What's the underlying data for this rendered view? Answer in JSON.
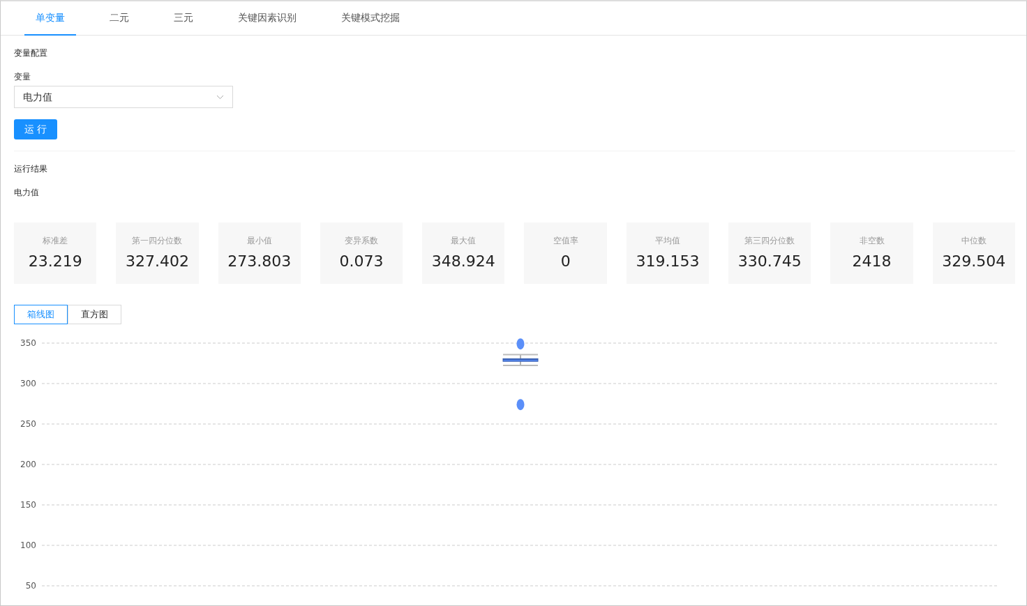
{
  "tabs": [
    {
      "label": "单变量",
      "selected": true
    },
    {
      "label": "二元",
      "selected": false
    },
    {
      "label": "三元",
      "selected": false
    },
    {
      "label": "关键因素识别",
      "selected": false
    },
    {
      "label": "关键模式挖掘",
      "selected": false
    }
  ],
  "config": {
    "title": "变量配置",
    "variable_label": "变量",
    "variable_value": "电力值",
    "run_button": "运 行"
  },
  "results": {
    "title": "运行结果",
    "variable": "电力值",
    "stats": [
      {
        "label": "标准差",
        "value": "23.219"
      },
      {
        "label": "第一四分位数",
        "value": "327.402"
      },
      {
        "label": "最小值",
        "value": "273.803"
      },
      {
        "label": "变异系数",
        "value": "0.073"
      },
      {
        "label": "最大值",
        "value": "348.924"
      },
      {
        "label": "空值率",
        "value": "0"
      },
      {
        "label": "平均值",
        "value": "319.153"
      },
      {
        "label": "第三四分位数",
        "value": "330.745"
      },
      {
        "label": "非空数",
        "value": "2418"
      },
      {
        "label": "中位数",
        "value": "329.504"
      }
    ],
    "chart_tabs": [
      {
        "label": "箱线图",
        "selected": true
      },
      {
        "label": "直方图",
        "selected": false
      }
    ],
    "chart_data": {
      "type": "scatter",
      "grid": true,
      "categories": [
        null
      ],
      "ylim": [
        50,
        350
      ],
      "yticks": [
        50,
        100,
        150,
        200,
        250,
        300,
        350
      ],
      "series": [
        {
          "color": "#5b8ff9",
          "values": [
            349
          ]
        },
        {
          "color": "#5b8ff9",
          "values": [
            274
          ]
        }
      ]
    }
  }
}
